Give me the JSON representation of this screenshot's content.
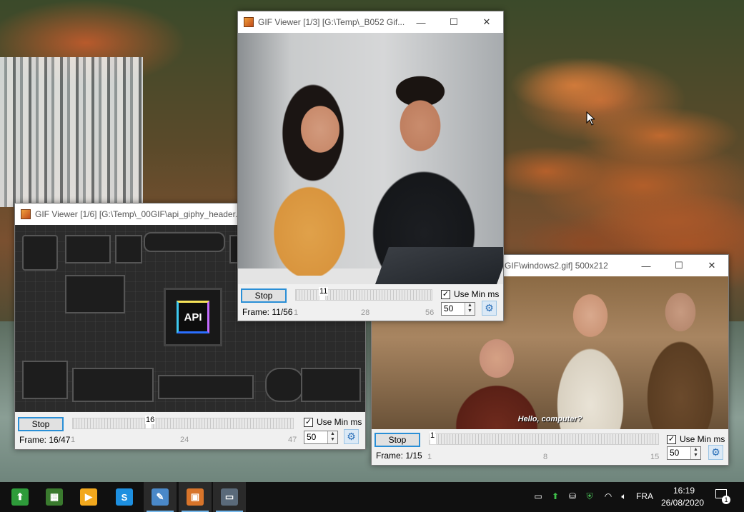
{
  "windows": {
    "left": {
      "title": "GIF Viewer [1/6] [G:\\Temp\\_00GIF\\api_giphy_header.gif",
      "stop_label": "Stop",
      "frame_label": "Frame: 16/47",
      "slider_value": "16",
      "progress_fraction": 0.34,
      "ticks": [
        "1",
        "24",
        "47"
      ],
      "use_min_ms_label": "Use Min ms",
      "use_min_ms_checked": "✓",
      "min_ms_value": "50",
      "chip_label": "API"
    },
    "center": {
      "title": "GIF Viewer [1/3] [G:\\Temp\\_B052 Gif...",
      "stop_label": "Stop",
      "frame_label": "Frame: 11/56",
      "slider_value": "11",
      "progress_fraction": 0.18,
      "ticks": [
        "1",
        "28",
        "56"
      ],
      "use_min_ms_label": "Use Min ms",
      "use_min_ms_checked": "✓",
      "min_ms_value": "50"
    },
    "right": {
      "title": "GIF\\windows2.gif] 500x212",
      "stop_label": "Stop",
      "frame_label": "Frame: 1/15",
      "slider_value": "1",
      "progress_fraction": 0.0,
      "ticks": [
        "1",
        "8",
        "15"
      ],
      "use_min_ms_label": "Use Min ms",
      "use_min_ms_checked": "✓",
      "min_ms_value": "50",
      "caption": "Hello, computer?"
    }
  },
  "window_buttons": {
    "minimize": "—",
    "maximize": "☐",
    "close": "✕"
  },
  "taskbar": {
    "apps": [
      {
        "name": "green-up-arrow-app",
        "glyph": "⬆",
        "color": "#2e9b3a"
      },
      {
        "name": "grid-app",
        "glyph": "▦",
        "color": "#3a7a2e"
      },
      {
        "name": "media-player-app",
        "glyph": "▶",
        "color": "#f2a81d"
      },
      {
        "name": "s-app",
        "glyph": "S",
        "color": "#1d8fe0"
      },
      {
        "name": "notepad-app",
        "glyph": "✎",
        "color": "#4a88c8"
      },
      {
        "name": "gif-viewer-app",
        "glyph": "▣",
        "color": "#d8742a"
      },
      {
        "name": "display-app",
        "glyph": "▭",
        "color": "#5a6a7a"
      }
    ],
    "language": "FRA",
    "time": "16:19",
    "date": "26/08/2020",
    "notification_count": "1"
  },
  "colors": {
    "accent": "#2a8fd6",
    "taskbar": "#101010"
  }
}
